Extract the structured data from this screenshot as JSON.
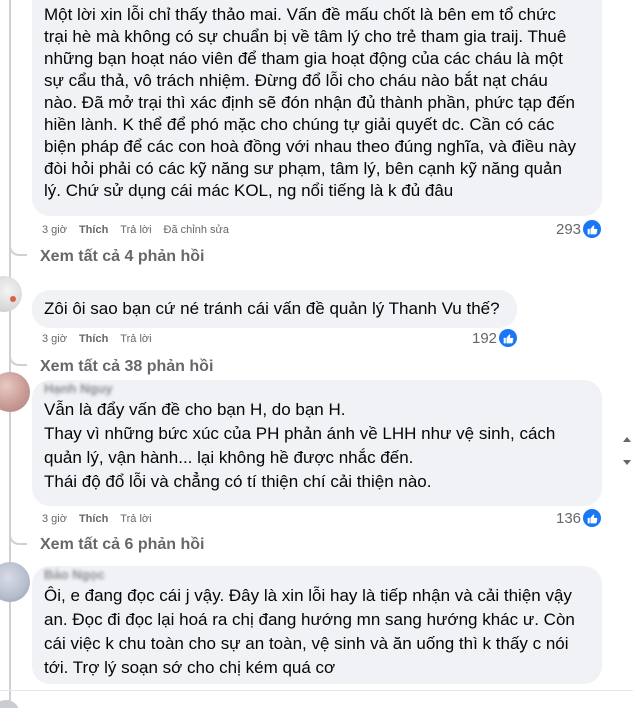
{
  "comments": [
    {
      "lines": [
        "Một lời xin lỗi chỉ thấy thảo mai. Vấn đề mấu chốt là bên em tổ chức",
        "trại hè mà không có sự chuẩn bị về tâm lý cho trẻ tham gia traij. Thuê",
        "những bạn hoạt náo viên để tham gia hoạt động của các cháu là một",
        "sự cẩu thả, vô trách nhiệm. Đừng đổ lỗi cho cháu nào bắt nạt cháu",
        "nào. Đã mở trại thì xác định sẽ đón nhận đủ thành phần, phức tạp đến",
        "hiền lành. K thể để phó mặc cho chúng tự giải quyết dc. Cần có các",
        "biện pháp để các con hoà đồng với nhau theo đúng nghĩa, và điều này",
        "đòi hỏi phải có các kỹ năng sư phạm, tâm lý, bên cạnh kỹ năng quản",
        "lý. Chứ sử dụng cái mác KOL, ng nổi tiếng là k đủ đâu"
      ],
      "time": "3 giờ",
      "like": "Thích",
      "reply": "Trả lời",
      "edited": "Đã chỉnh sửa",
      "reaction_count": "293",
      "view_replies": "Xem tất cả 4 phản hồi"
    },
    {
      "lines": [
        "Zôi ôi sao bạn cứ né tránh cái vấn đề quản lý Thanh Vu thế?"
      ],
      "time": "3 giờ",
      "like": "Thích",
      "reply": "Trả lời",
      "reaction_count": "192",
      "view_replies": "Xem tất cả 38 phản hồi"
    },
    {
      "author": "Hạnh Nguy",
      "lines": [
        "Vẫn là đẩy vấn đề cho bạn H, do bạn H.",
        "Thay vì những bức xúc của PH phản ánh về LHH như vệ sinh, cách",
        "quản lý, vận hành... lại không hề được nhắc đến.",
        "Thái độ đổ lỗi và chẳng có tí thiện chí cải thiện nào."
      ],
      "time": "3 giờ",
      "like": "Thích",
      "reply": "Trả lời",
      "reaction_count": "136",
      "view_replies": "Xem tất cả 6 phản hồi"
    },
    {
      "author": "Bảo Ngọc",
      "lines": [
        "Ôi, e đang đọc cái j vậy. Đây là xin lỗi hay là tiếp nhận và cải thiện vậy",
        "an. Đọc đi đọc lại hoá ra chị đang hướng mn sang hướng khác ư. Còn",
        "cái việc k chu toàn cho sự an toàn, vệ sinh và ăn uống thì k thấy c nói",
        "tới. Trợ lý soạn sớ cho chị kém quá cơ"
      ]
    }
  ],
  "icons": {
    "like": "thumbs-up-icon",
    "scroll_up": "scroll-up-icon",
    "scroll_down": "scroll-down-icon"
  },
  "colors": {
    "bubble": "#f0f2f5",
    "meta": "#65676b",
    "like_blue": "#1877f2"
  }
}
